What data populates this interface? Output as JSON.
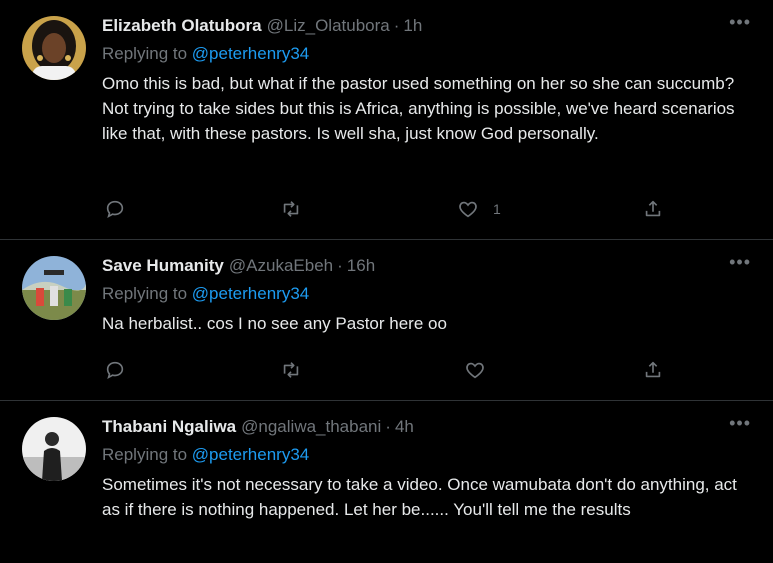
{
  "tweets": [
    {
      "name": "Elizabeth Olatubora",
      "handle": "@Liz_Olatubora",
      "separator": "·",
      "time": "1h",
      "replying_prefix": "Replying to",
      "replying_to": "@peterhenry34",
      "text": "Omo this is bad, but what if the pastor used something on her so she can succumb? Not trying to take sides but this is Africa, anything is possible, we've heard scenarios like that, with these pastors. Is well sha, just know God personally.",
      "like_count": "1",
      "more_icon": "more-horizontal-icon"
    },
    {
      "name": "Save Humanity",
      "handle": "@AzukaEbeh",
      "separator": "·",
      "time": "16h",
      "replying_prefix": "Replying to",
      "replying_to": "@peterhenry34",
      "text": "Na herbalist.. cos I no see any Pastor here oo",
      "like_count": "",
      "more_icon": "more-horizontal-icon"
    },
    {
      "name": "Thabani Ngaliwa",
      "handle": "@ngaliwa_thabani",
      "separator": "·",
      "time": "4h",
      "replying_prefix": "Replying to",
      "replying_to": "@peterhenry34",
      "text": "Sometimes it's not necessary to take a video. Once wamubata don't do anything, act as if there is nothing happened. Let her be...... You'll tell me the results",
      "like_count": "",
      "more_icon": "more-horizontal-icon"
    }
  ],
  "icons": [
    "reply-icon",
    "retweet-icon",
    "like-icon",
    "share-icon"
  ],
  "colors": {
    "background": "#000000",
    "primary_text": "#e7e9ea",
    "secondary_text": "#71767b",
    "link": "#1d9bf0",
    "divider": "#2f3336"
  }
}
